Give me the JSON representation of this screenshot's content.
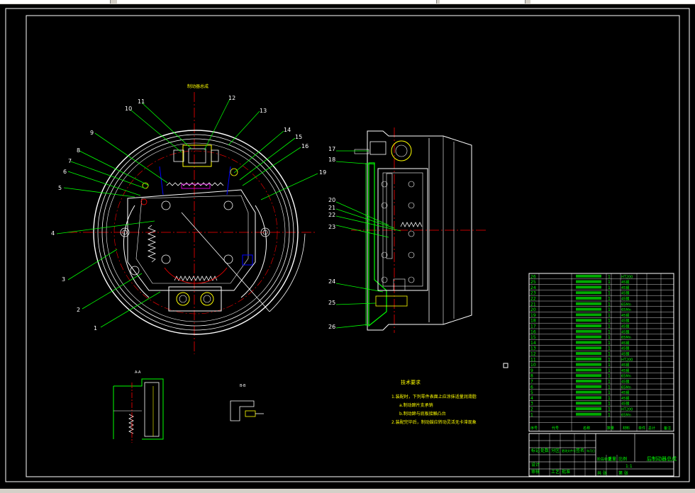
{
  "drawing": {
    "main_view_label": "制动器总成",
    "part_numbers": [
      "1",
      "2",
      "3",
      "4",
      "5",
      "6",
      "7",
      "8",
      "9",
      "10",
      "11",
      "12",
      "13",
      "14",
      "15",
      "16",
      "19"
    ],
    "side_view_numbers": [
      "17",
      "18",
      "20",
      "21",
      "22",
      "23",
      "24",
      "25",
      "26"
    ],
    "section_a_label": "A-A",
    "section_b_label": "B-B",
    "tech_requirements": {
      "title": "技术要求",
      "lines": [
        "1.装配时，下列零件表面上应涂抹适量润滑脂",
        "a.制动蹄片支承销",
        "b.制动蹄与底板接触凸台",
        "2.装配完毕后，制动鼓应转动灵活无卡滞现象"
      ]
    },
    "title_block": {
      "drawing_name": "后制动器总成",
      "cells": [
        "标记",
        "处数",
        "分区",
        "更改文件号",
        "签名",
        "年月日",
        "设计",
        "审核",
        "工艺",
        "批准",
        "阶段标记",
        "重量",
        "比例",
        "共 张",
        "第 张",
        "1:1"
      ],
      "header_labels": [
        "序号",
        "代号",
        "名称",
        "数量",
        "材料",
        "单件",
        "总计",
        "备注"
      ]
    },
    "bom_materials": [
      "HT200",
      "45钢",
      "45钢",
      "45钢",
      "45钢",
      "65Mn",
      "65Mn",
      "45钢",
      "45钢",
      "45钢",
      "45钢",
      "65Mn",
      "45钢",
      "45钢",
      "45钢",
      "HT200",
      "45钢",
      "45钢",
      "65Mn",
      "45钢",
      "65Mn",
      "45钢",
      "45钢",
      "45钢",
      "HT200",
      "65Mn"
    ]
  },
  "colors": {
    "background": "#000000",
    "frame": "#ffffff",
    "outline": "#ffffff",
    "centerline": "#ff0000",
    "leader": "#00ff00",
    "part": "#ffff00",
    "hidden": "#0000ff",
    "accent": "#ff00ff"
  }
}
